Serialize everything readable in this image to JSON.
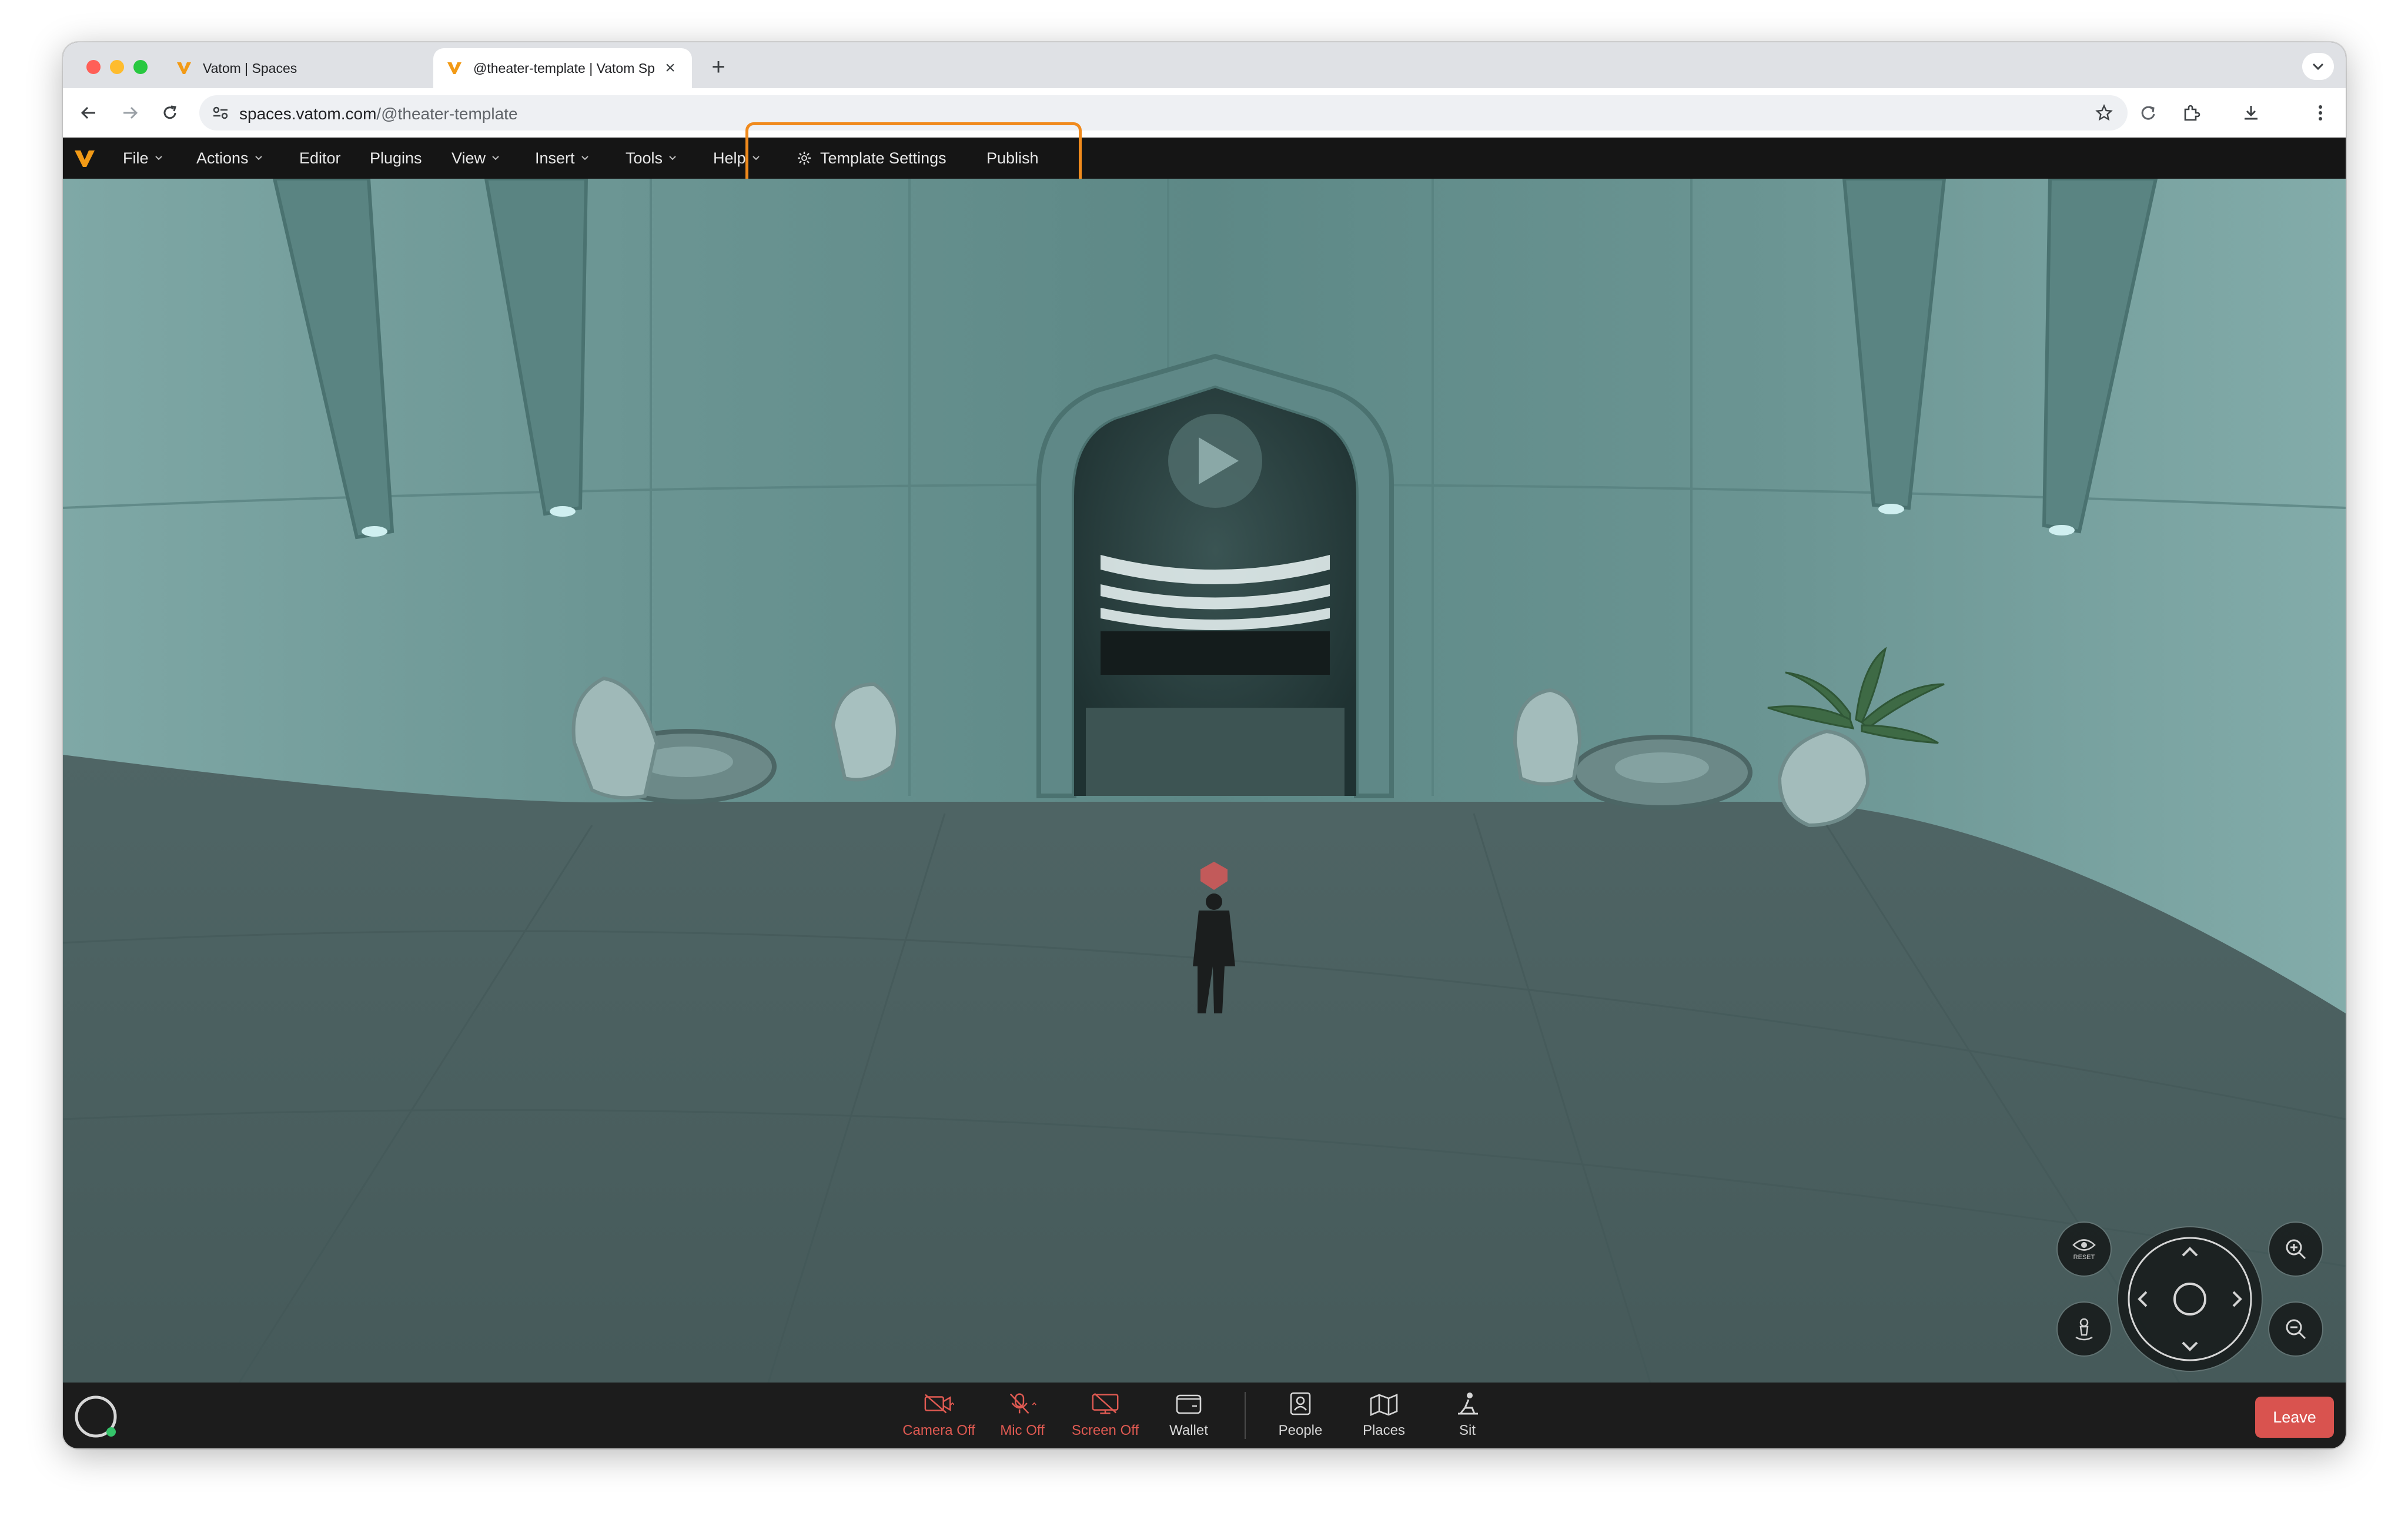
{
  "browser": {
    "tabs": [
      {
        "title": "Vatom | Spaces",
        "active": false
      },
      {
        "title": "@theater-template | Vatom Sp",
        "active": true
      }
    ],
    "url_host": "spaces.vatom.com",
    "url_path": "/@theater-template"
  },
  "menubar": {
    "items": [
      {
        "label": "File",
        "has_dropdown": true
      },
      {
        "label": "Actions",
        "has_dropdown": true
      },
      {
        "label": "Editor",
        "has_dropdown": false
      },
      {
        "label": "Plugins",
        "has_dropdown": false
      },
      {
        "label": "View",
        "has_dropdown": true
      },
      {
        "label": "Insert",
        "has_dropdown": true
      },
      {
        "label": "Tools",
        "has_dropdown": true
      },
      {
        "label": "Help",
        "has_dropdown": true
      }
    ],
    "template_settings": "Template Settings",
    "publish": "Publish",
    "highlight_color": "#f08a1c"
  },
  "controls": {
    "reset_label": "RESET"
  },
  "bottombar": {
    "buttons": [
      {
        "label": "Camera Off",
        "icon": "camera-off-icon",
        "state": "off"
      },
      {
        "label": "Mic Off",
        "icon": "mic-off-icon",
        "state": "off"
      },
      {
        "label": "Screen Off",
        "icon": "screen-off-icon",
        "state": "off"
      },
      {
        "label": "Wallet",
        "icon": "wallet-icon",
        "state": "on"
      },
      {
        "label": "People",
        "icon": "people-icon",
        "state": "on"
      },
      {
        "label": "Places",
        "icon": "places-icon",
        "state": "on"
      },
      {
        "label": "Sit",
        "icon": "sit-icon",
        "state": "on"
      }
    ],
    "leave": "Leave",
    "off_color": "#e05a52",
    "leave_color": "#d9534f"
  }
}
